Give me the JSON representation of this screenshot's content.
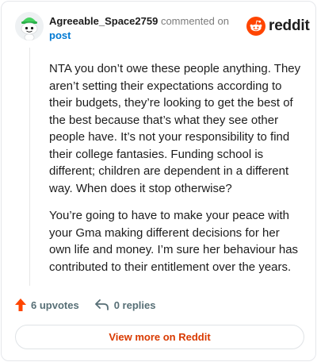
{
  "header": {
    "username": "Agreeable_Space2759",
    "commented_text": "commented on",
    "post_link": "post"
  },
  "brand": {
    "wordmark": "reddit",
    "logo_icon": "reddit-snoo-icon",
    "accent_color": "#ff4500"
  },
  "comment": {
    "paragraphs": [
      "NTA you don’t owe these people anything. They aren’t setting their expectations according to their budgets, they’re looking to get the best of the best because that’s what they see other people have. It’s not your responsibility to find their college fantasies. Funding school is different; children are dependent in a different way. When does it stop otherwise?",
      "You’re going to have to make your peace with your Gma making different decisions for her own life and money. I’m sure her behaviour has contributed to their entitlement over the years."
    ]
  },
  "actions": {
    "upvotes_label": "6 upvotes",
    "replies_label": "0 replies",
    "upvote_icon": "upvote-arrow-icon",
    "reply_icon": "reply-arrow-icon",
    "upvote_color": "#ff4500"
  },
  "footer": {
    "view_more_label": "View more on Reddit",
    "view_more_color": "#d93a00"
  }
}
